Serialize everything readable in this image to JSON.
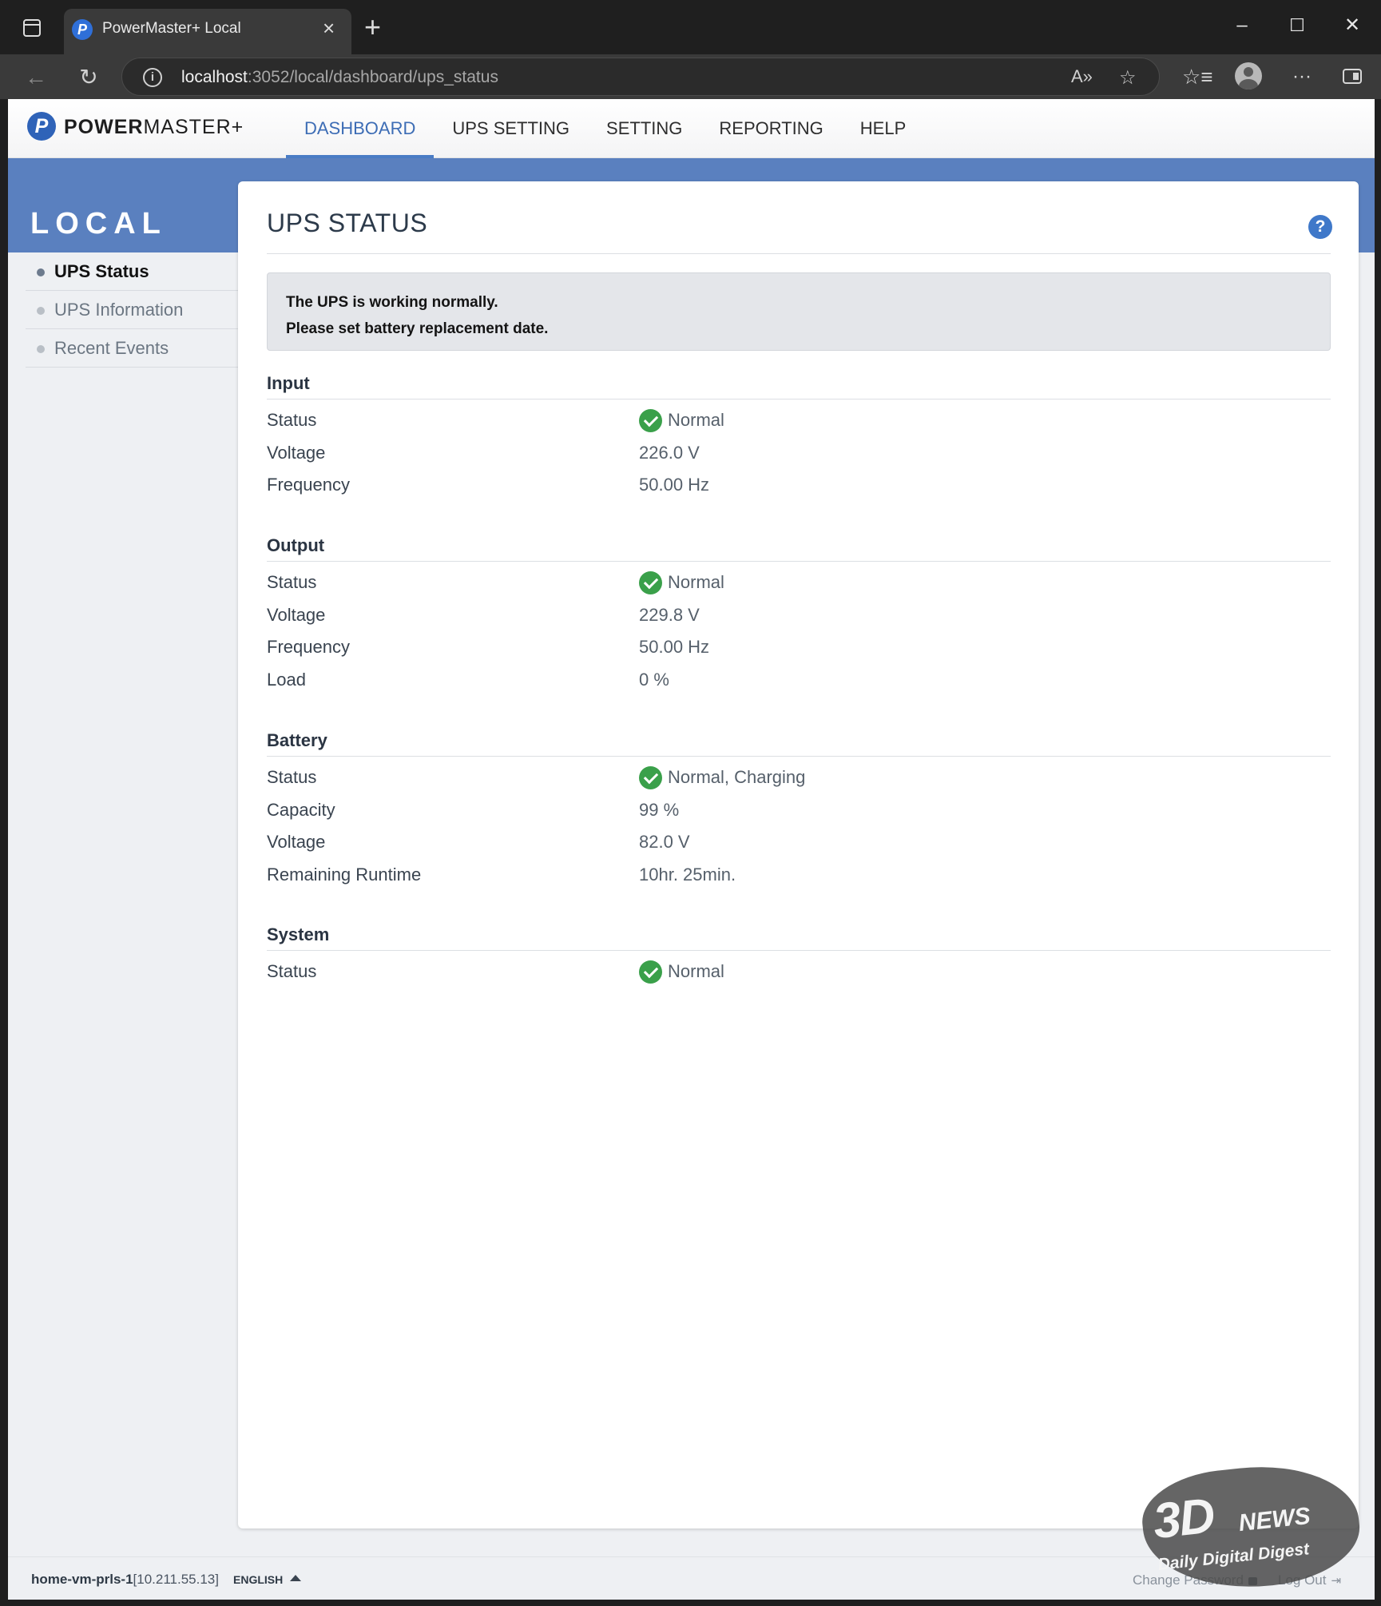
{
  "browser": {
    "tab_title": "PowerMaster+ Local",
    "tab_favicon": "P",
    "url_host": "localhost",
    "url_path": ":3052/local/dashboard/ups_status",
    "icons": [
      "tab-actions-icon",
      "close-icon",
      "plus-icon",
      "back-icon",
      "reload-icon",
      "info-icon",
      "read-aloud-icon",
      "star-icon",
      "favorites-icon",
      "profile-icon",
      "more-icon",
      "sidebar-icon",
      "minimize-icon",
      "maximize-icon",
      "window-close-icon"
    ]
  },
  "app": {
    "logo_mark": "P",
    "logo_bold": "POWER",
    "logo_rest": "MASTER+",
    "nav": [
      "DASHBOARD",
      "UPS SETTING",
      "SETTING",
      "REPORTING",
      "HELP"
    ],
    "nav_active": "DASHBOARD",
    "accent_color": "#5a80bf",
    "ok_color": "#3aa04a"
  },
  "sidebar": {
    "heading": "LOCAL",
    "items": [
      {
        "label": "UPS Status",
        "active": true
      },
      {
        "label": "UPS Information",
        "active": false
      },
      {
        "label": "Recent Events",
        "active": false
      }
    ]
  },
  "content": {
    "title": "UPS STATUS",
    "help_icon": "?",
    "notice": [
      "The UPS is working normally.",
      "Please set battery replacement date."
    ],
    "sections": [
      {
        "title": "Input",
        "rows": [
          {
            "label": "Status",
            "value": "Normal",
            "icon": "check-icon"
          },
          {
            "label": "Voltage",
            "value": "226.0 V"
          },
          {
            "label": "Frequency",
            "value": "50.00 Hz"
          }
        ]
      },
      {
        "title": "Output",
        "rows": [
          {
            "label": "Status",
            "value": "Normal",
            "icon": "check-icon"
          },
          {
            "label": "Voltage",
            "value": "229.8 V"
          },
          {
            "label": "Frequency",
            "value": "50.00 Hz"
          },
          {
            "label": "Load",
            "value": "0 %"
          }
        ]
      },
      {
        "title": "Battery",
        "rows": [
          {
            "label": "Status",
            "value": "Normal, Charging",
            "icon": "check-icon"
          },
          {
            "label": "Capacity",
            "value": "99 %"
          },
          {
            "label": "Voltage",
            "value": "82.0 V"
          },
          {
            "label": "Remaining Runtime",
            "value": "10hr. 25min."
          }
        ]
      },
      {
        "title": "System",
        "rows": [
          {
            "label": "Status",
            "value": "Normal",
            "icon": "check-icon"
          }
        ]
      }
    ]
  },
  "footer": {
    "hostname": "home-vm-prls-1",
    "ip": "[10.211.55.13]",
    "language": "ENGLISH",
    "change_password": "Change Password",
    "log_out": "Log Out"
  },
  "watermark": {
    "brand": "3D",
    "news": "NEWS",
    "tagline": "Daily Digital Digest"
  }
}
